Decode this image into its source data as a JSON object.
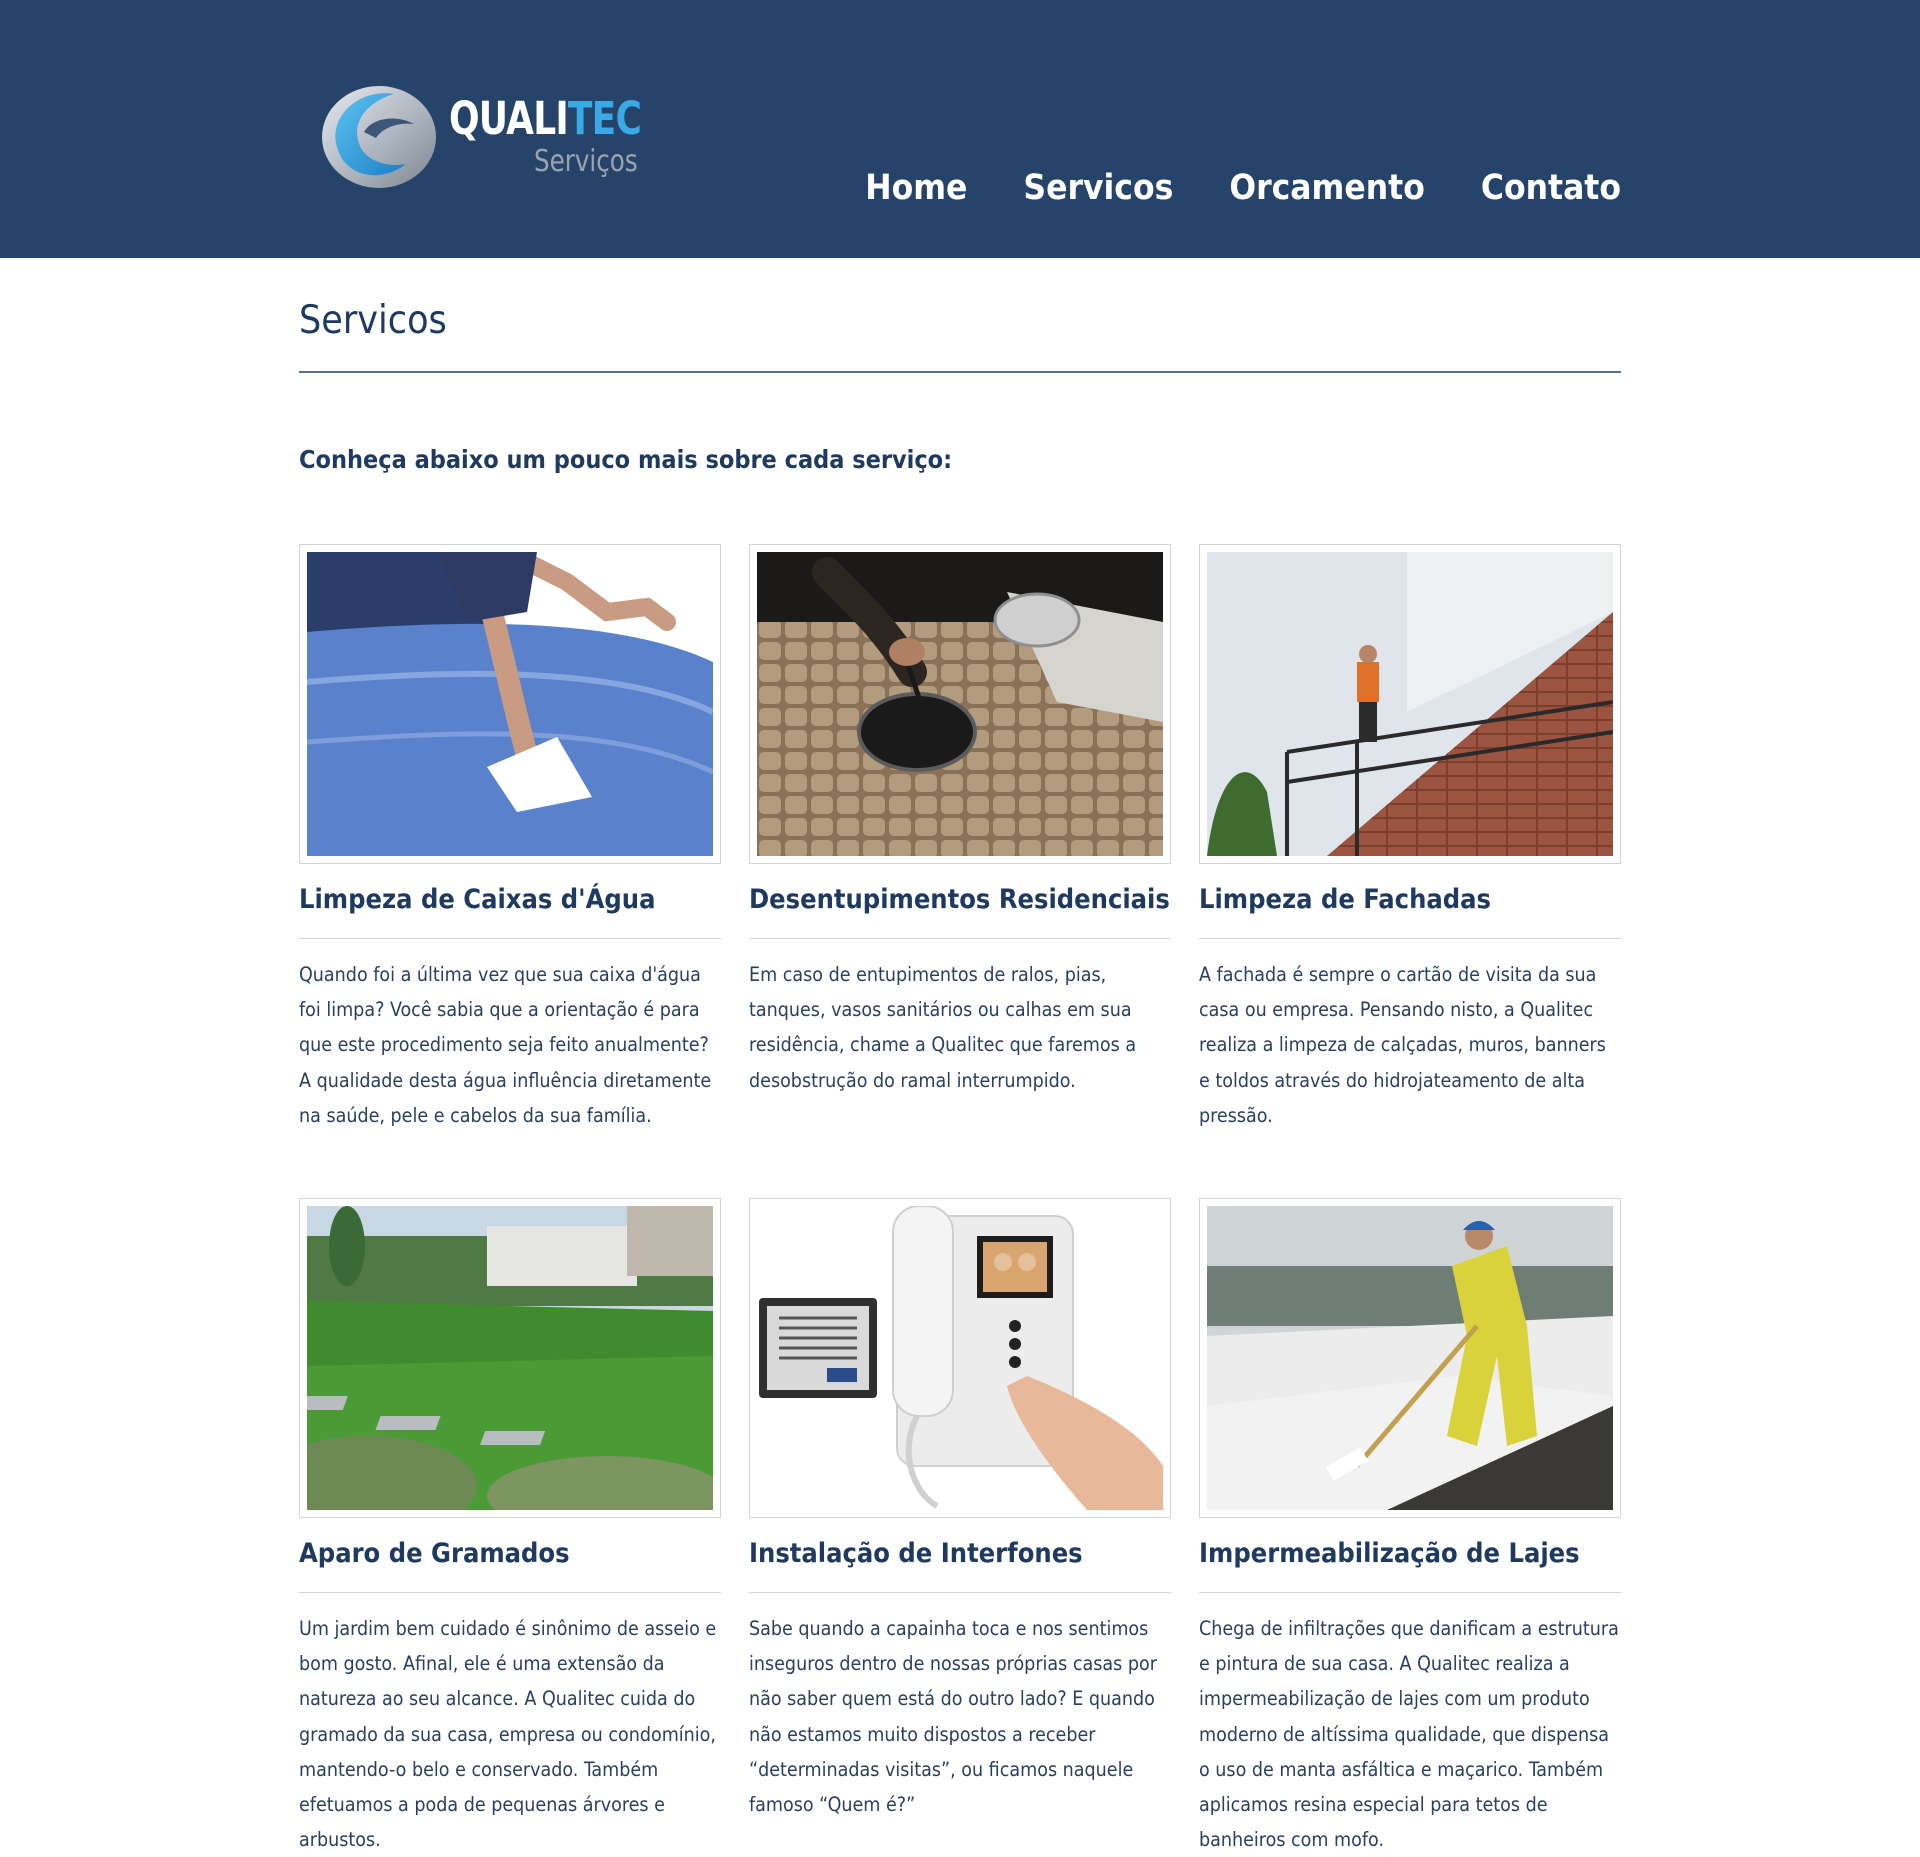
{
  "brand": {
    "name_part1": "QUALI",
    "name_part2": "TEC",
    "subtitle": "Serviços"
  },
  "nav": [
    "Home",
    "Servicos",
    "Orcamento",
    "Contato"
  ],
  "page": {
    "title": "Servicos",
    "intro": "Conheça abaixo um pouco mais sobre cada serviço:"
  },
  "services": [
    {
      "title": "Limpeza de Caixas d'Água",
      "text": "Quando foi a última vez que sua caixa d'água foi limpa? Você sabia que a orientação é para que este procedimento seja feito anualmente? A qualidade desta água influência diretamente na saúde, pele e cabelos da sua família."
    },
    {
      "title": "Desentupimentos Residenciais",
      "text": "Em caso de entupimentos de ralos, pias, tanques, vasos sanitários ou calhas em sua residência, chame a Qualitec que faremos a desobstrução do ramal interrumpido."
    },
    {
      "title": "Limpeza de Fachadas",
      "text": "A fachada é sempre o cartão de visita da sua casa ou empresa. Pensando nisto, a Qualitec realiza a limpeza de calçadas, muros, banners e toldos através do hidrojateamento de alta pressão."
    },
    {
      "title": "Aparo de Gramados",
      "text": "Um jardim bem cuidado é sinônimo de asseio e bom gosto. Afinal, ele é uma extensão da natureza ao seu alcance. A Qualitec cuida do gramado da sua casa, empresa ou condomínio, mantendo-o belo e conservado. Também efetuamos a poda de pequenas árvores e arbustos."
    },
    {
      "title": "Instalação de Interfones",
      "text": "Sabe quando a capainha toca e nos sentimos inseguros dentro de nossas próprias casas por não saber quem está do outro lado? E quando não estamos muito dispostos a receber “determinadas visitas”, ou ficamos naquele famoso “Quem é?”"
    },
    {
      "title": "Impermeabilização de Lajes",
      "text": "Chega de infiltrações que danificam a estrutura e pintura de sua casa. A Qualitec realiza a impermeabilização de lajes com um produto moderno de altíssima qualidade, que dispensa o uso de manta asfáltica e maçarico. Também aplicamos resina especial para tetos de banheiros com mofo."
    }
  ],
  "colors": {
    "header_bg": "#26446a",
    "heading": "#1f3a60",
    "accent": "#3aa9e6"
  }
}
